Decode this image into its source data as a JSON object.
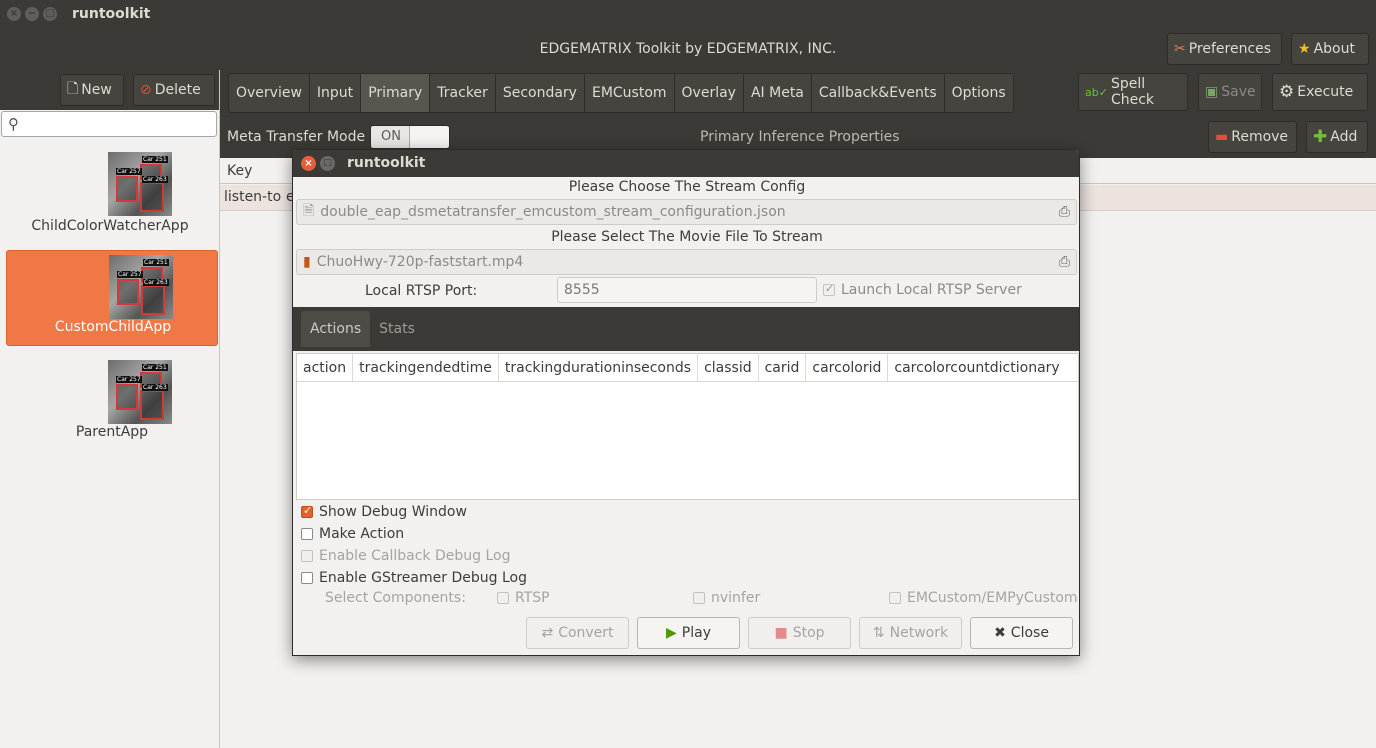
{
  "window": {
    "title": "runtoolkit"
  },
  "header": {
    "title": "EDGEMATRIX Toolkit by EDGEMATRIX, INC.",
    "preferences_label": "Preferences",
    "about_label": "About"
  },
  "sidebar": {
    "new_label": "New",
    "delete_label": "Delete",
    "search_placeholder": "",
    "apps": [
      {
        "label": "ChildColorWatcherApp",
        "selected": false
      },
      {
        "label": "CustomChildApp",
        "selected": true
      },
      {
        "label": "ParentApp",
        "selected": false
      }
    ],
    "thumb_tags": [
      "Car 257",
      "Car 251",
      "Car 263"
    ]
  },
  "main": {
    "tabs": [
      "Overview",
      "Input",
      "Primary",
      "Tracker",
      "Secondary",
      "EMCustom",
      "Overlay",
      "AI Meta",
      "Callback&Events",
      "Options"
    ],
    "active_tab": "Primary",
    "spell_check_label": "Spell Check",
    "save_label": "Save",
    "execute_label": "Execute",
    "meta_transfer_label": "Meta Transfer Mode",
    "toggle_state": "ON",
    "section_title": "Primary Inference Properties",
    "remove_label": "Remove",
    "add_label": "Add",
    "table_header_key": "Key",
    "row_key": "listen-to",
    "row_value_fragment": "e"
  },
  "dialog": {
    "title": "runtoolkit",
    "stream_config_heading": "Please Choose The Stream Config",
    "stream_config_file": "double_eap_dsmetatransfer_emcustom_stream_configuration.json",
    "movie_heading": "Please Select The Movie File To Stream",
    "movie_file": "ChuoHwy-720p-faststart.mp4",
    "rtsp_port_label": "Local RTSP Port:",
    "rtsp_port_value": "8555",
    "launch_rtsp_label": "Launch Local RTSP Server",
    "tabs": [
      "Actions",
      "Stats"
    ],
    "active_tab": "Actions",
    "columns": [
      "action",
      "trackingendedtime",
      "trackingdurationinseconds",
      "classid",
      "carid",
      "carcolorid",
      "carcolorcountdictionary"
    ],
    "show_debug_label": "Show Debug Window",
    "make_action_label": "Make Action",
    "callback_debug_label": "Enable Callback Debug Log",
    "gstreamer_debug_label": "Enable GStreamer Debug Log",
    "select_components_label": "Select Components:",
    "component_rtsp": "RTSP",
    "component_nvinfer": "nvinfer",
    "component_emcustom": "EMCustom/EMPyCustom",
    "buttons": {
      "convert": "Convert",
      "play": "Play",
      "stop": "Stop",
      "network": "Network",
      "close": "Close"
    }
  }
}
